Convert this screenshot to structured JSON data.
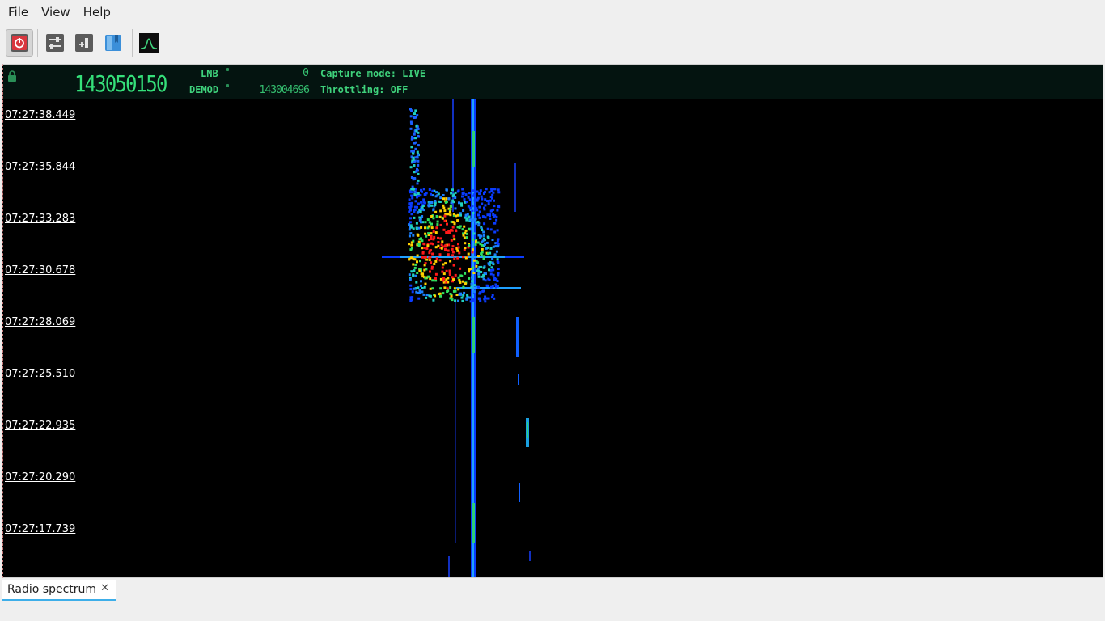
{
  "menu": [
    "File",
    "View",
    "Help"
  ],
  "toolbar": {
    "buttons": [
      {
        "name": "power-button",
        "icon": "power-icon",
        "active": true
      },
      {
        "name": "panel-settings-button",
        "icon": "settings-panel-icon"
      },
      {
        "name": "add-bookmark-button",
        "icon": "bookmark-add-icon"
      },
      {
        "name": "bookmarks-button",
        "icon": "bookmarks-icon"
      },
      {
        "name": "spectrum-button",
        "icon": "spectrum-icon"
      }
    ]
  },
  "header": {
    "frequency": "143050150",
    "lnb_label": "LNB",
    "lnb_value": "0",
    "demod_label": "DEMOD",
    "demod_value": "143004696",
    "capture_mode": "Capture mode: LIVE",
    "throttling": "Throttling: OFF"
  },
  "waterfall": {
    "timestamps": [
      "07:27:38.449",
      "07:27:35.844",
      "07:27:33.283",
      "07:27:30.678",
      "07:27:28.069",
      "07:27:25.510",
      "07:27:22.935",
      "07:27:20.290",
      "07:27:17.739"
    ]
  },
  "tabs": [
    {
      "label": "Radio spectrum"
    }
  ]
}
